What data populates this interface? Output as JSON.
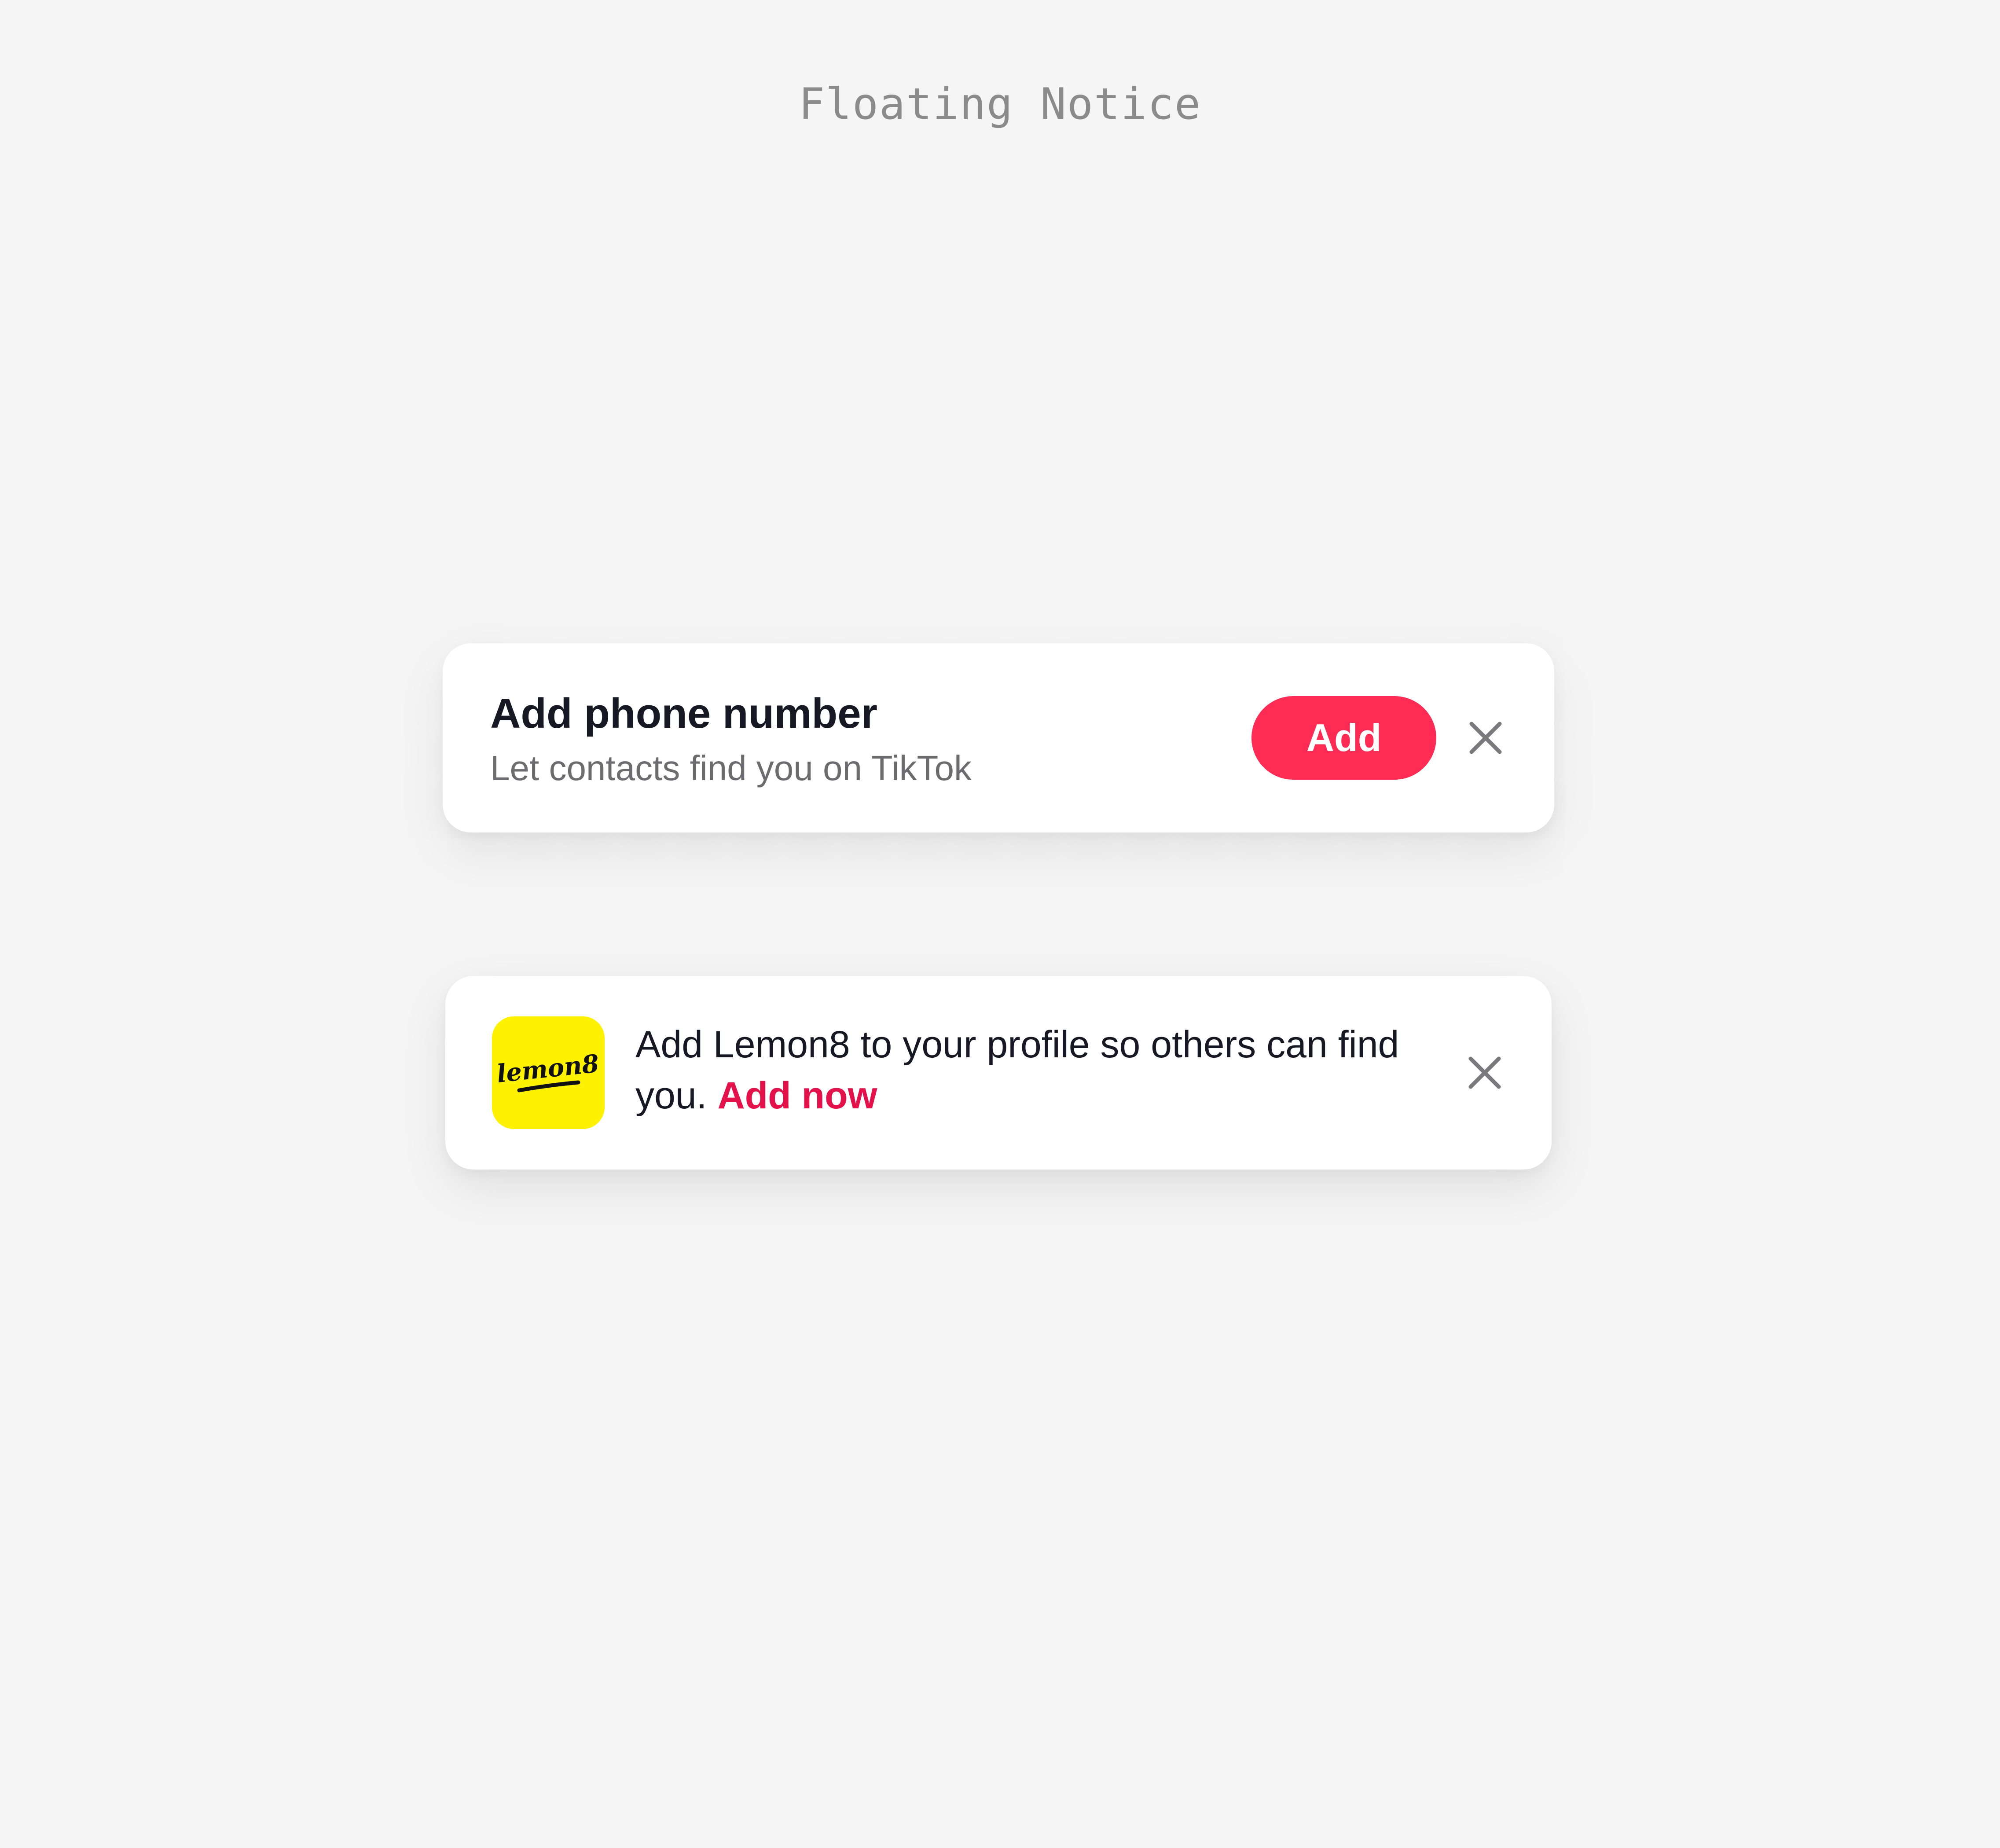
{
  "page": {
    "title": "Floating Notice"
  },
  "phone_notice": {
    "title": "Add phone number",
    "subtitle": "Let contacts find you on TikTok",
    "add_button_label": "Add",
    "close_icon": "close-icon"
  },
  "lemon_notice": {
    "logo_text": "lemon8",
    "message": "Add Lemon8 to your profile so others can find you.",
    "link_label": "Add now",
    "close_icon": "close-icon"
  },
  "colors": {
    "background": "#f5f5f5",
    "accent": "#fe2c55",
    "link": "#e3124a",
    "lemon_yellow": "#fff200",
    "title_text": "#161823",
    "secondary_text": "#6b6b70",
    "page_title_text": "#8b8b8b"
  }
}
